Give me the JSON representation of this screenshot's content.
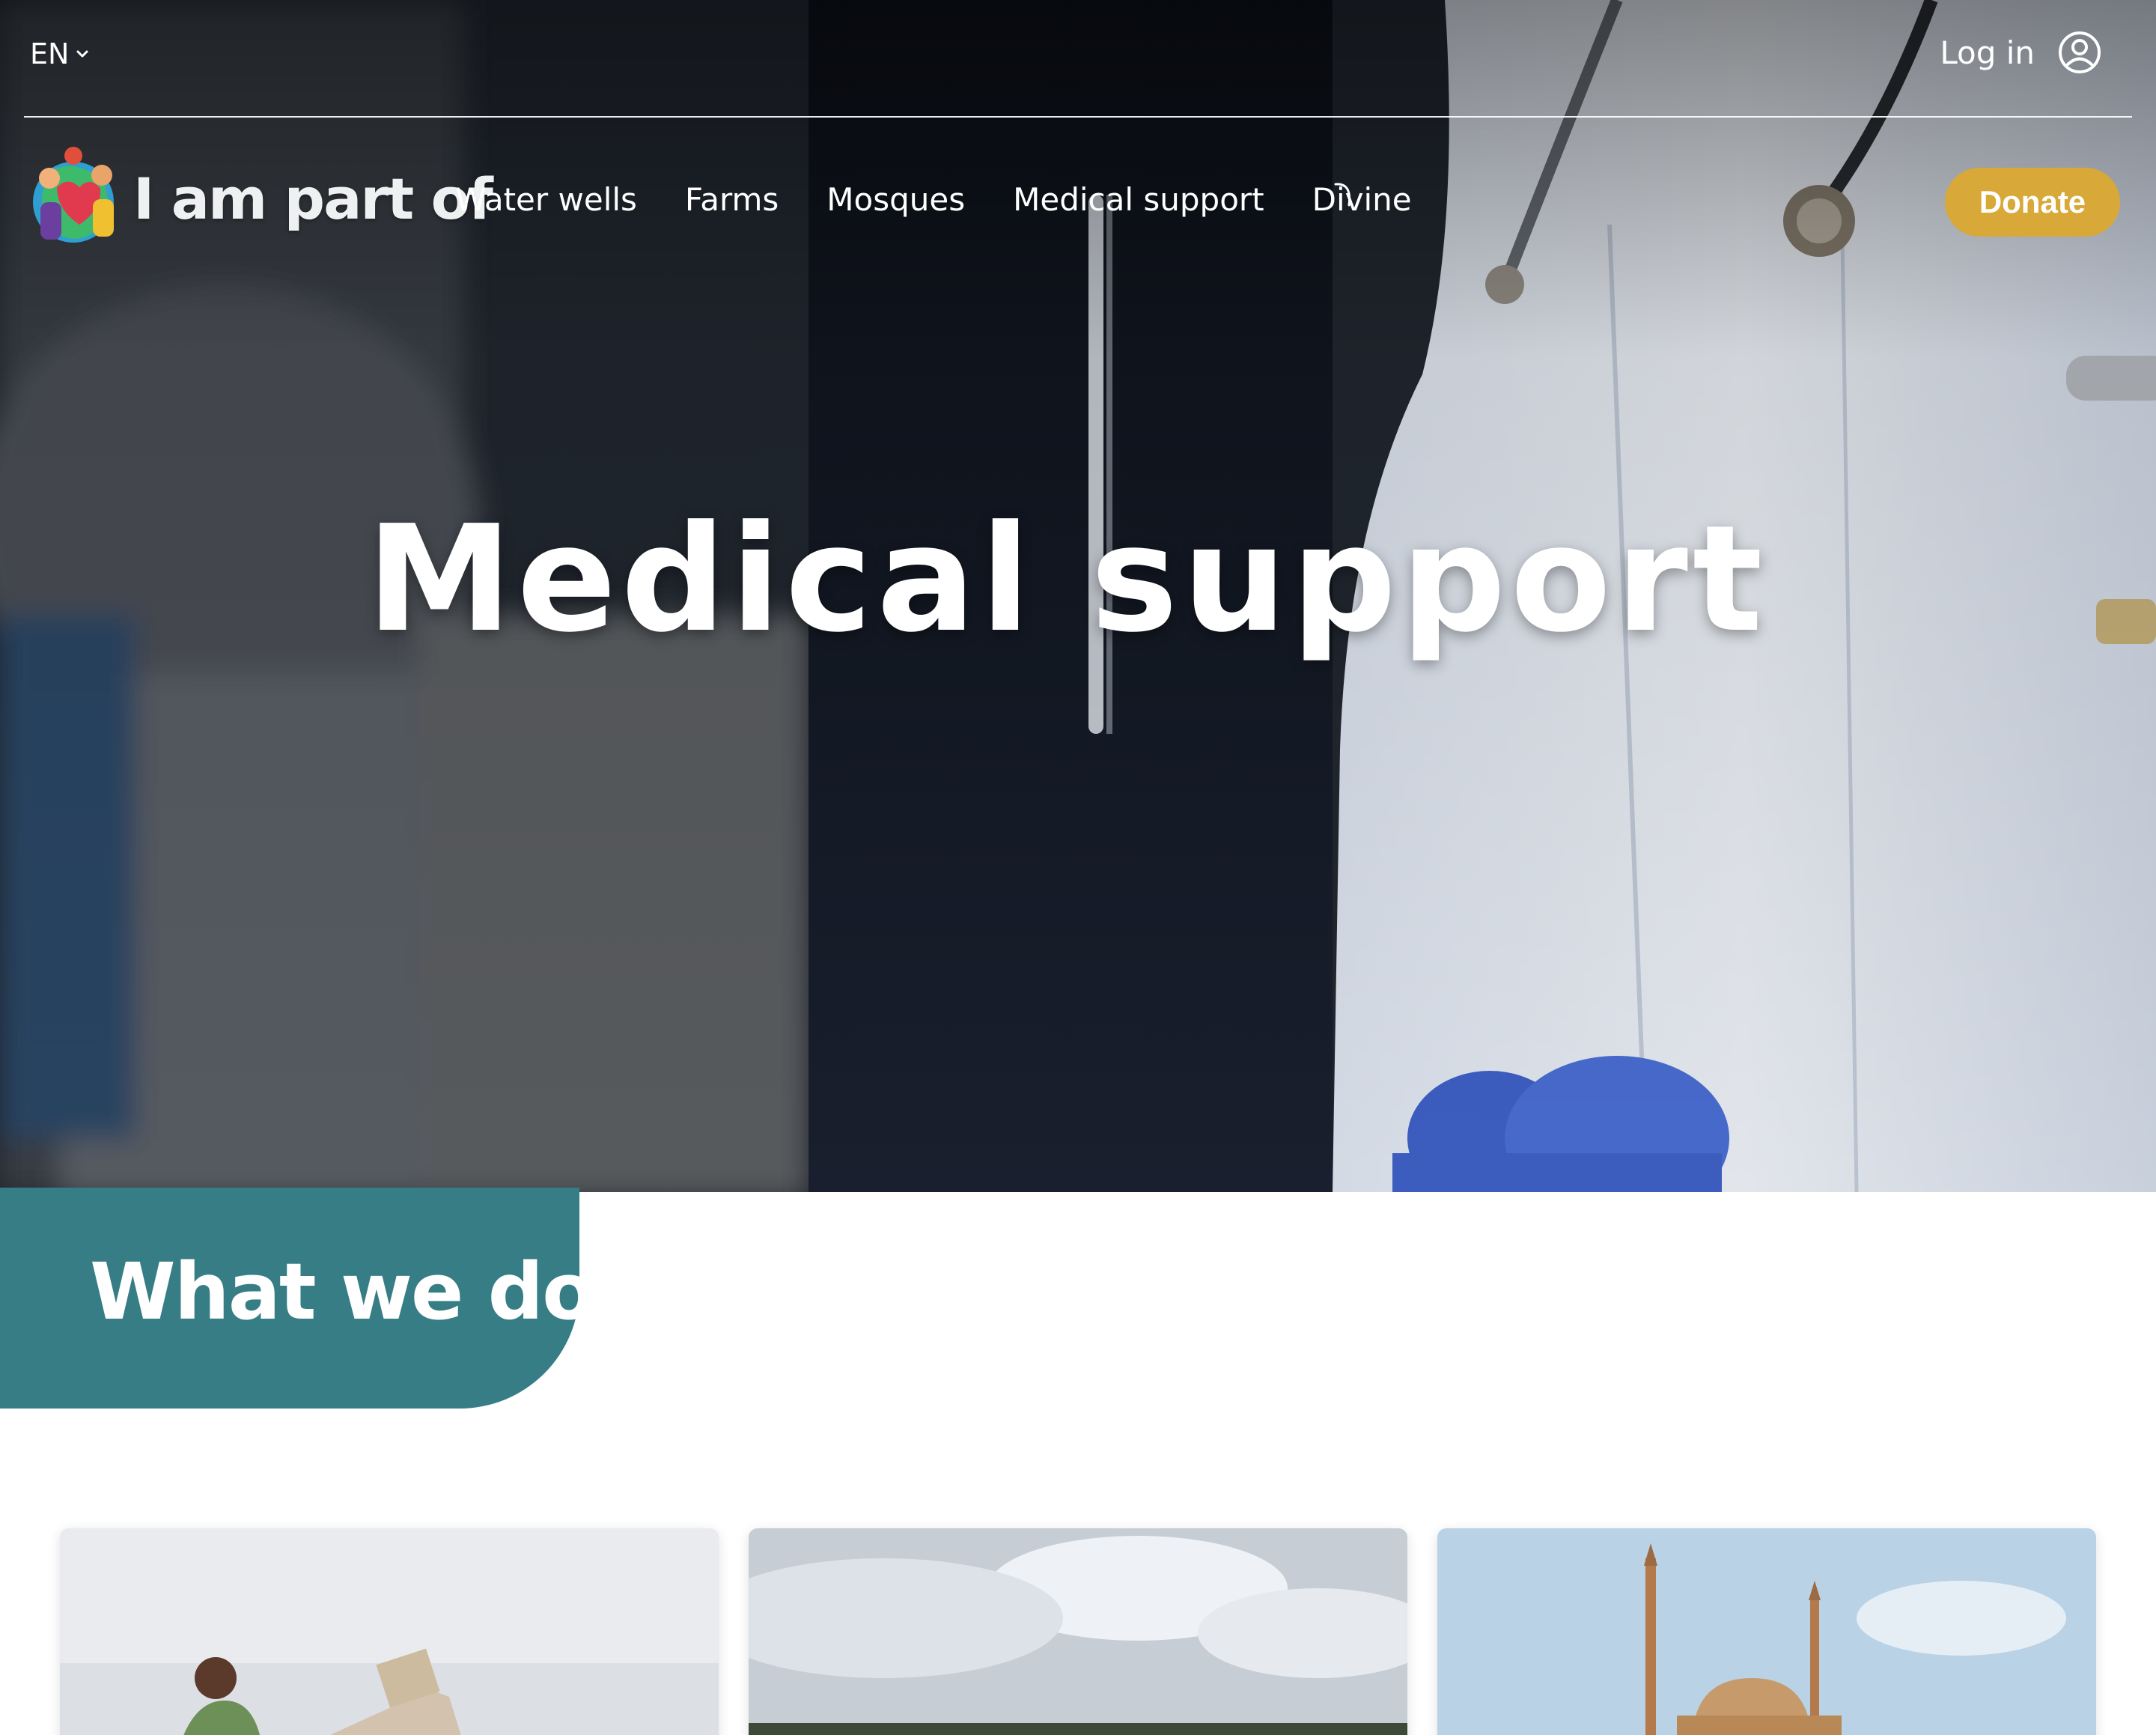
{
  "header": {
    "language": "EN",
    "login_label": "Log in",
    "logo_text": "I am part of"
  },
  "nav": {
    "items": [
      {
        "label": "Water wells"
      },
      {
        "label": "Farms"
      },
      {
        "label": "Mosques"
      },
      {
        "label": "Medical support"
      },
      {
        "label": "Divine"
      }
    ],
    "donate_label": "Donate"
  },
  "hero": {
    "title": "Medical support"
  },
  "section": {
    "title": "What we do"
  },
  "colors": {
    "donate": "#d8a938",
    "section_tab": "#367d85"
  },
  "icons": {
    "language_toggle": "chevron-down-icon",
    "login": "user-circle-icon"
  }
}
